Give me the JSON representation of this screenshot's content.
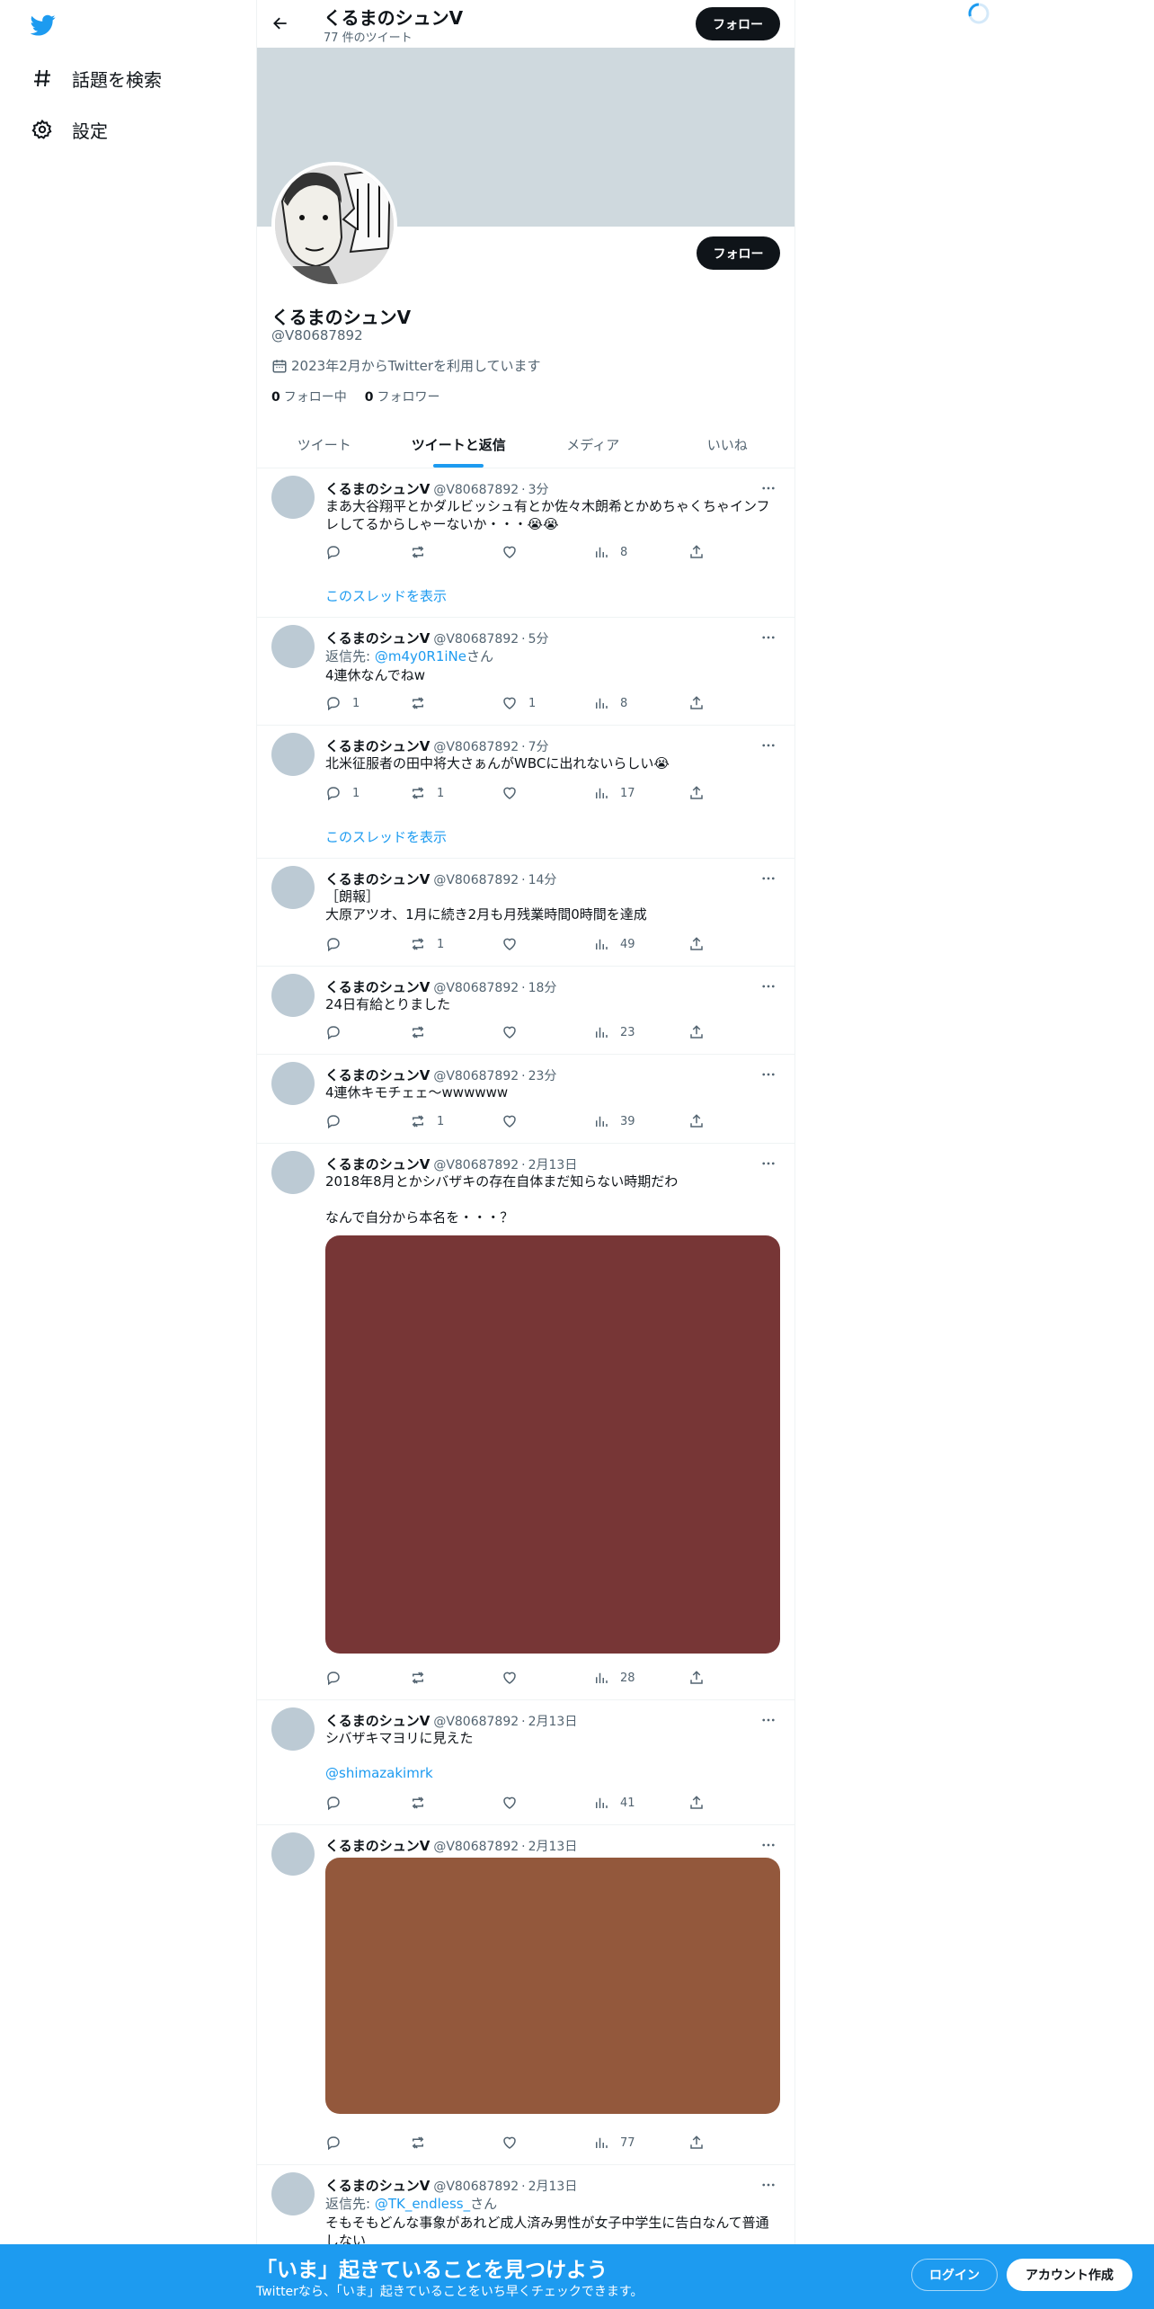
{
  "sidebar": {
    "items": [
      {
        "label": "話題を検索",
        "icon": "hashtag-icon"
      },
      {
        "label": "設定",
        "icon": "gear-icon"
      }
    ]
  },
  "header": {
    "name": "くるまのシュンV",
    "tweet_count": "77 件のツイート",
    "follow_label": "フォロー"
  },
  "profile": {
    "name": "くるまのシュンV",
    "handle": "@V80687892",
    "joined": "2023年2月からTwitterを利用しています",
    "following_count": "0",
    "following_label": "フォロー中",
    "followers_count": "0",
    "followers_label": "フォロワー",
    "follow_label": "フォロー"
  },
  "tabs": [
    {
      "label": "ツイート",
      "active": false
    },
    {
      "label": "ツイートと返信",
      "active": true
    },
    {
      "label": "メディア",
      "active": false
    },
    {
      "label": "いいね",
      "active": false
    }
  ],
  "tweets": [
    {
      "name": "くるまのシュンV",
      "handle": "@V80687892",
      "dot": "·",
      "time": "3分",
      "reply_prefix": "",
      "reply_to": "",
      "reply_suffix": "",
      "text": "まあ大谷翔平とかダルビッシュ有とか佐々木朗希とかめちゃくちゃインフレしてるからしゃーないか・・・😭😭",
      "replies": "",
      "retweets": "",
      "likes": "",
      "views": "8",
      "show_thread": "このスレッドを表示"
    },
    {
      "name": "くるまのシュンV",
      "handle": "@V80687892",
      "dot": "·",
      "time": "5分",
      "reply_prefix": "返信先: ",
      "reply_to": "@m4y0R1iNe",
      "reply_suffix": "さん",
      "text": "4連休なんでねw",
      "replies": "1",
      "retweets": "",
      "likes": "1",
      "views": "8",
      "show_thread": ""
    },
    {
      "name": "くるまのシュンV",
      "handle": "@V80687892",
      "dot": "·",
      "time": "7分",
      "reply_prefix": "",
      "reply_to": "",
      "reply_suffix": "",
      "text": "北米征服者の田中将大さぁんがWBCに出れないらしい😭",
      "replies": "1",
      "retweets": "1",
      "likes": "",
      "views": "17",
      "show_thread": "このスレッドを表示"
    },
    {
      "name": "くるまのシュンV",
      "handle": "@V80687892",
      "dot": "·",
      "time": "14分",
      "reply_prefix": "",
      "reply_to": "",
      "reply_suffix": "",
      "text": "［朗報］\n大原アツオ、1月に続き2月も月残業時間0時間を達成",
      "replies": "",
      "retweets": "1",
      "likes": "",
      "views": "49",
      "show_thread": ""
    },
    {
      "name": "くるまのシュンV",
      "handle": "@V80687892",
      "dot": "·",
      "time": "18分",
      "reply_prefix": "",
      "reply_to": "",
      "reply_suffix": "",
      "text": "24日有給とりました",
      "replies": "",
      "retweets": "",
      "likes": "",
      "views": "23",
      "show_thread": ""
    },
    {
      "name": "くるまのシュンV",
      "handle": "@V80687892",
      "dot": "·",
      "time": "23分",
      "reply_prefix": "",
      "reply_to": "",
      "reply_suffix": "",
      "text": "4連休キモチェェ〜wwwwww",
      "replies": "",
      "retweets": "1",
      "likes": "",
      "views": "39",
      "show_thread": ""
    },
    {
      "name": "くるまのシュンV",
      "handle": "@V80687892",
      "dot": "·",
      "time": "2月13日",
      "reply_prefix": "",
      "reply_to": "",
      "reply_suffix": "",
      "text": "2018年8月とかシバザキの存在自体まだ知らない時期だわ\n\nなんで自分から本名を・・・？",
      "media_color": "#773636",
      "replies": "",
      "retweets": "",
      "likes": "",
      "views": "28",
      "show_thread": ""
    },
    {
      "name": "くるまのシュンV",
      "handle": "@V80687892",
      "dot": "·",
      "time": "2月13日",
      "reply_prefix": "",
      "reply_to": "",
      "reply_suffix": "",
      "text": "シバザキマヨリに見えた",
      "link": "@shimazakimrk",
      "replies": "",
      "retweets": "",
      "likes": "",
      "views": "41",
      "show_thread": ""
    },
    {
      "name": "くるまのシュンV",
      "handle": "@V80687892",
      "dot": "·",
      "time": "2月13日",
      "reply_prefix": "",
      "reply_to": "",
      "reply_suffix": "",
      "text": "",
      "media_color": "#93583c",
      "replies": "",
      "retweets": "",
      "likes": "",
      "views": "77",
      "show_thread": ""
    },
    {
      "name": "くるまのシュンV",
      "handle": "@V80687892",
      "dot": "·",
      "time": "2月13日",
      "reply_prefix": "返信先: ",
      "reply_to": "@TK_endless_",
      "reply_suffix": "さん",
      "text": "そもそもどんな事象があれど成人済み男性が女子中学生に告白なんて普通しない",
      "replies": "",
      "retweets": "",
      "likes": "",
      "views": "",
      "show_thread": ""
    }
  ],
  "bottom_bar": {
    "title": "「いま」起きていることを見つけよう",
    "subtitle": "Twitterなら、「いま」起きていることをいち早くチェックできます。",
    "login_label": "ログイン",
    "signup_label": "アカウント作成"
  },
  "colors": {
    "accent": "#1d9bf0",
    "banner": "#cfd9de"
  }
}
